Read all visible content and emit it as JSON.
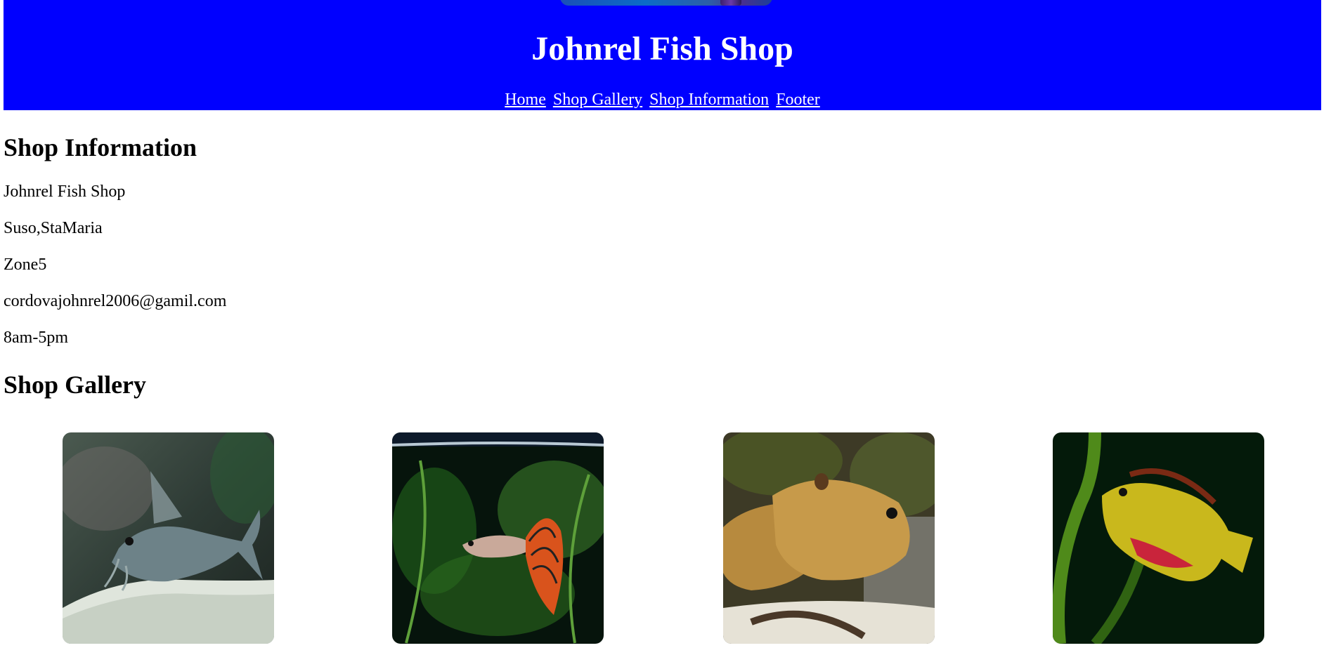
{
  "header": {
    "title": "Johnrel Fish Shop",
    "background_color": "#0000ff",
    "nav": [
      {
        "label": "Home"
      },
      {
        "label": "Shop Gallery"
      },
      {
        "label": "Shop Information"
      },
      {
        "label": "Footer"
      }
    ]
  },
  "shop_info": {
    "heading": "Shop Information",
    "name": "Johnrel Fish Shop",
    "address": "Suso,StaMaria",
    "zone": "Zone5",
    "email": "cordovajohnrel2006@gamil.com",
    "hours": "8am-5pm"
  },
  "gallery": {
    "heading": "Shop Gallery",
    "items": [
      {
        "image": "catfish-photo",
        "caption": ""
      },
      {
        "image": "guppy-photo",
        "caption": ""
      },
      {
        "image": "cichlid-photo",
        "caption": ""
      },
      {
        "image": "kribensis-photo",
        "caption": ""
      }
    ]
  }
}
